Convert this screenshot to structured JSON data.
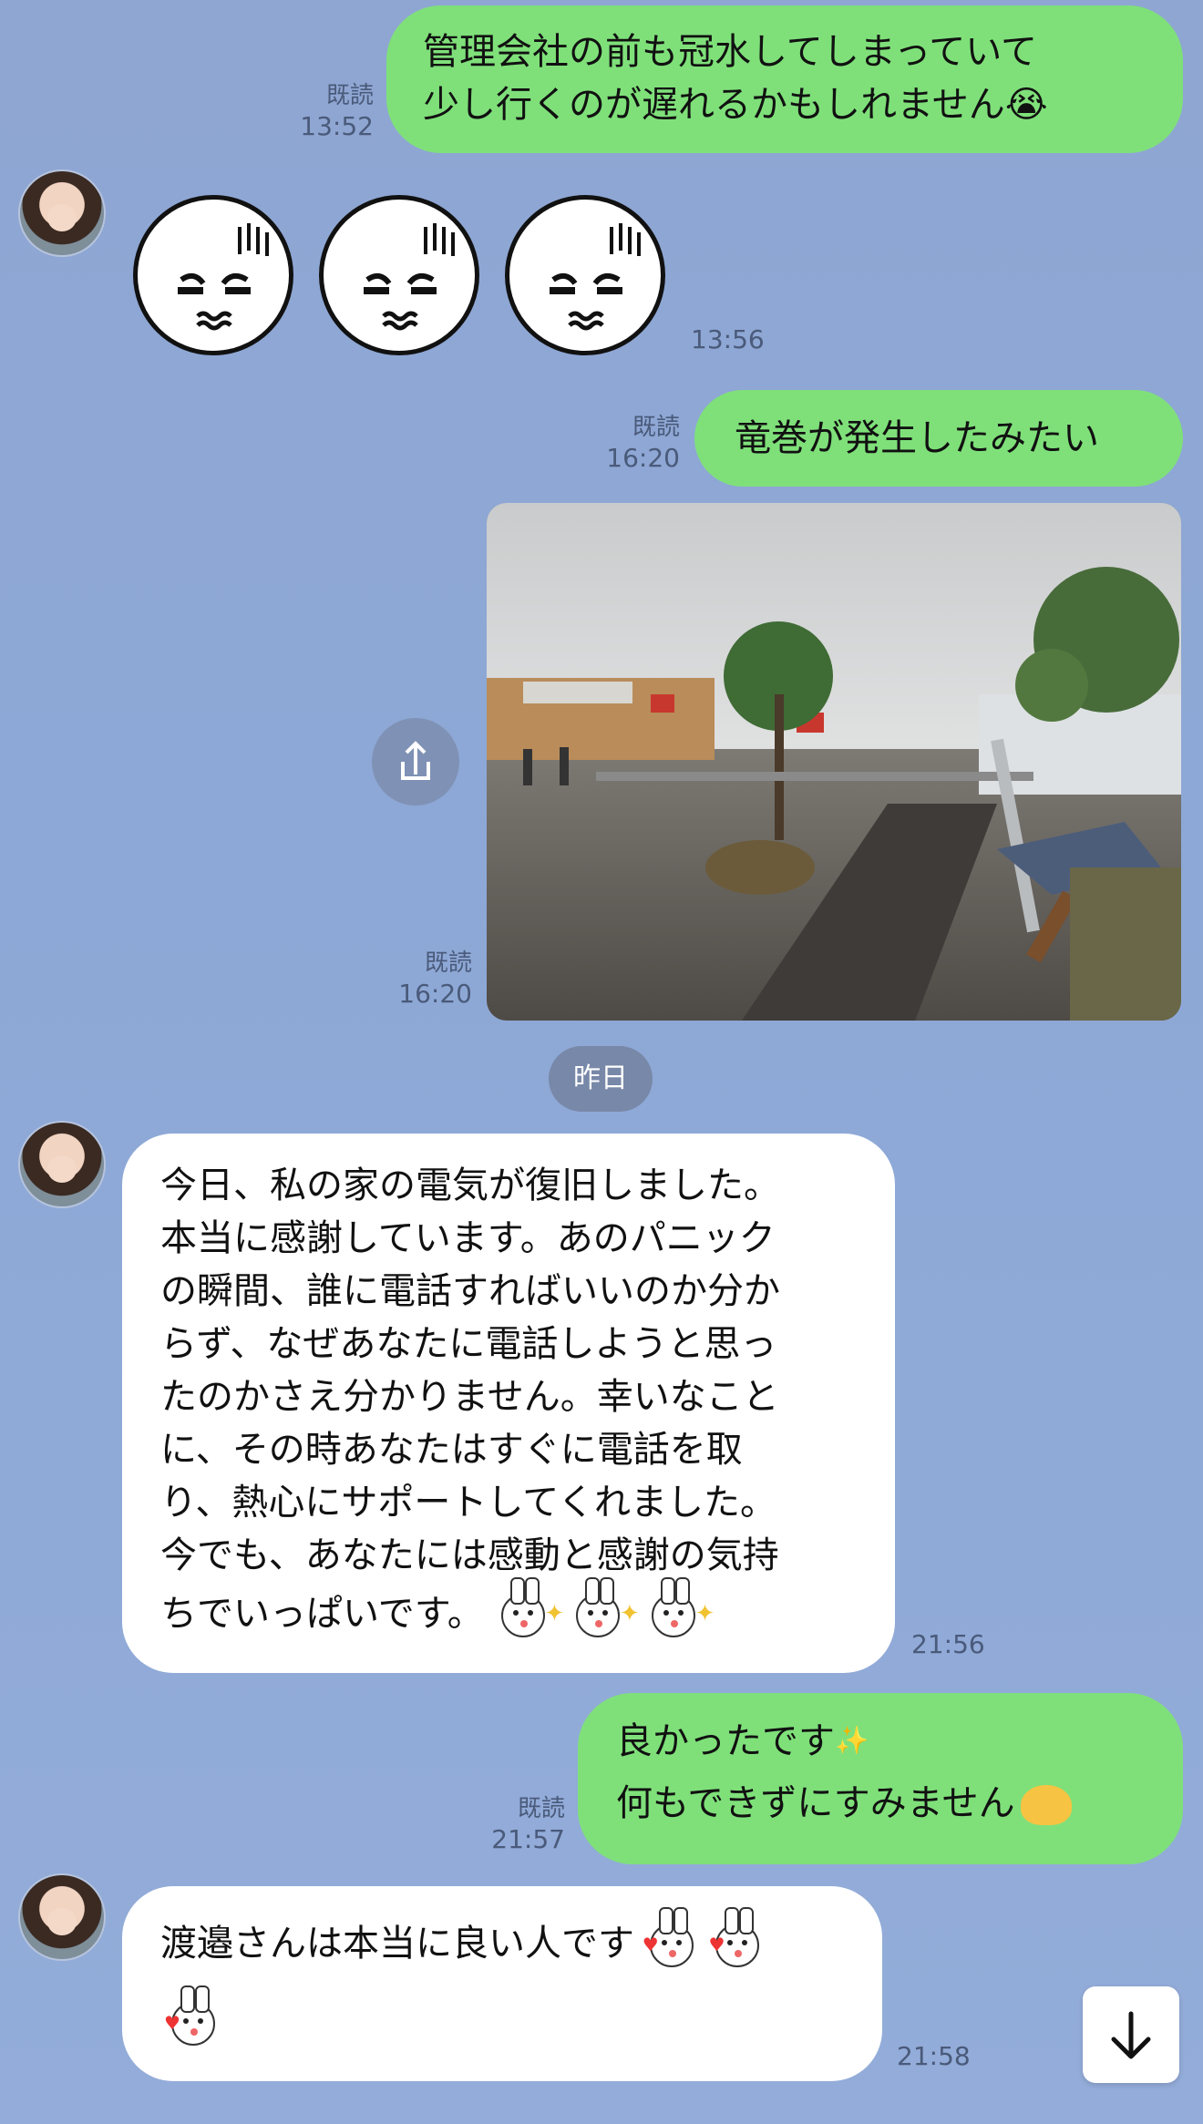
{
  "messages": {
    "m1": {
      "text_line1": "管理会社の前も冠水してしまっていて",
      "text_line2": "少し行くのが遅れるかもしれません",
      "emoji": "😭",
      "read": "既読",
      "time": "13:52"
    },
    "m2": {
      "sticker_name": "worried-face-sticker",
      "time": "13:56"
    },
    "m3": {
      "text": "竜巻が発生したみたい",
      "read": "既読",
      "time": "16:20"
    },
    "m4": {
      "read": "既読",
      "time": "16:20"
    },
    "date_divider": "昨日",
    "m5": {
      "lines": [
        "今日、私の家の電気が復旧しました。",
        "本当に感謝しています。あのパニック",
        "の瞬間、誰に電話すればいいのか分か",
        "らず、なぜあなたに電話しようと思っ",
        "たのかさえ分かりません。幸いなこと",
        "に、その時あなたはすぐに電話を取",
        "り、熱心にサポートしてくれました。",
        "今でも、あなたには感動と感謝の気持",
        "ちでいっぱいです。"
      ],
      "time": "21:56"
    },
    "m6": {
      "line1": "良かったです",
      "line2": "何もできずにすみません",
      "read": "既読",
      "time": "21:57"
    },
    "m7": {
      "text": "渡邉さんは本当に良い人です",
      "time": "21:58"
    }
  },
  "icons": {
    "share": "share-icon",
    "scroll_down": "arrow-down-icon"
  },
  "colors": {
    "bg": "#8fa6d2",
    "outgoing_bubble": "#7fe07a",
    "incoming_bubble": "#ffffff"
  }
}
